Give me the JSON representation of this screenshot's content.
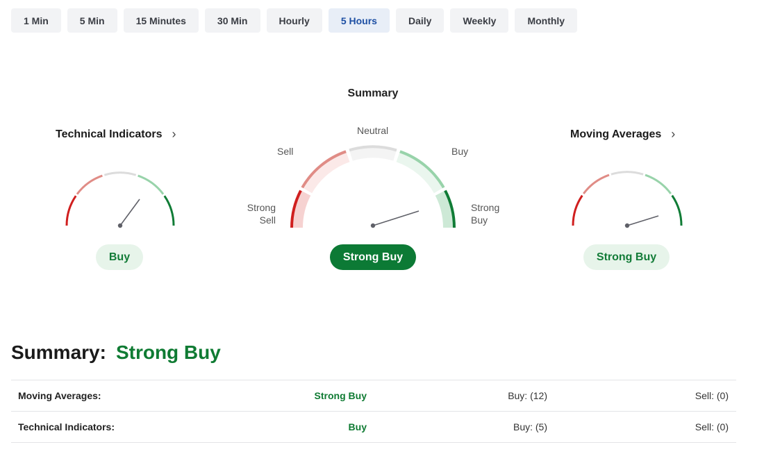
{
  "timeframes": [
    {
      "label": "1 Min",
      "active": false
    },
    {
      "label": "5 Min",
      "active": false
    },
    {
      "label": "15 Minutes",
      "active": false
    },
    {
      "label": "30 Min",
      "active": false
    },
    {
      "label": "Hourly",
      "active": false
    },
    {
      "label": "5 Hours",
      "active": true
    },
    {
      "label": "Daily",
      "active": false
    },
    {
      "label": "Weekly",
      "active": false
    },
    {
      "label": "Monthly",
      "active": false
    }
  ],
  "summary_title": "Summary",
  "technical": {
    "title": "Technical Indicators",
    "chevron": "›",
    "rating": "Buy"
  },
  "summary_gauge": {
    "labels": {
      "neutral": "Neutral",
      "sell": "Sell",
      "buy": "Buy",
      "strong_sell_1": "Strong",
      "strong_sell_2": "Sell",
      "strong_buy_1": "Strong",
      "strong_buy_2": "Buy"
    },
    "rating": "Strong Buy"
  },
  "moving_averages": {
    "title": "Moving Averages",
    "chevron": "›",
    "rating": "Strong Buy"
  },
  "summary_line": {
    "label": "Summary:",
    "value": "Strong Buy"
  },
  "table": [
    {
      "name": "Moving Averages:",
      "rating": "Strong Buy",
      "buy": "Buy: (12)",
      "sell": "Sell: (0)"
    },
    {
      "name": "Technical Indicators:",
      "rating": "Buy",
      "buy": "Buy: (5)",
      "sell": "Sell: (0)"
    }
  ],
  "colors": {
    "strong_sell": "#d01f1f",
    "sell": "#e08c86",
    "neutral": "#dcdcdc",
    "buy": "#98d3aa",
    "strong_buy": "#107c36",
    "needle": "#5f6068",
    "active_tab_text": "#1d4fa3"
  }
}
